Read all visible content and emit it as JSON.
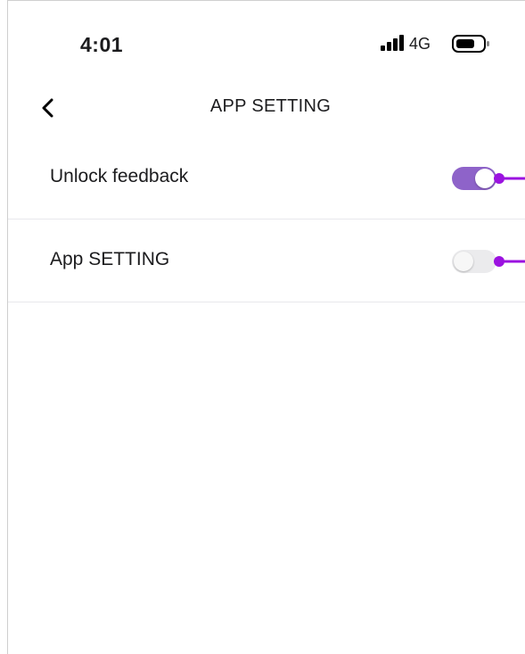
{
  "status_bar": {
    "time": "4:01",
    "network": "4G",
    "signal_icon": "cellular-signal-icon",
    "battery_icon": "battery-icon"
  },
  "nav": {
    "back_icon": "chevron-left-icon",
    "title": "APP SETTING"
  },
  "settings": [
    {
      "label": "Unlock feedback",
      "enabled": true
    },
    {
      "label": "App SETTING",
      "enabled": false
    }
  ],
  "colors": {
    "accent": "#8e63c9",
    "annotation": "#9b12e0",
    "toggle_off": "#ebebed"
  }
}
